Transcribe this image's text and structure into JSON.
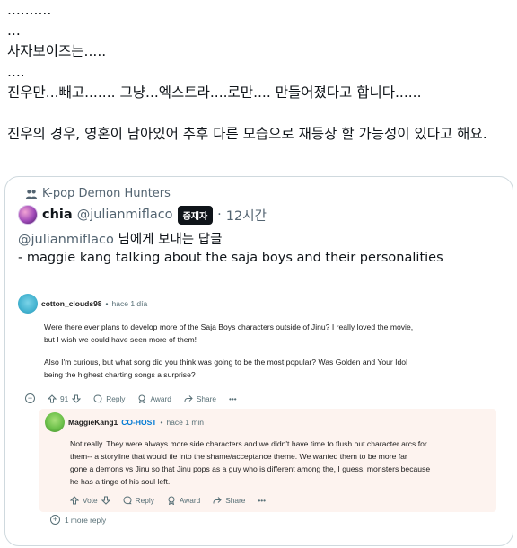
{
  "post": {
    "lines": [
      "..........",
      "...",
      "사자보이즈는.....",
      "....",
      "진우만...빼고....... 그냥...엑스트라....로만.... 만들어졌다고 합니다......",
      "",
      "진우의 경우, 영혼이 남아있어 추후 다른 모습으로 재등장 할 가능성이 있다고 해요."
    ]
  },
  "quote": {
    "community": "K-pop Demon Hunters",
    "author_name": "chia",
    "author_handle": "@julianmiflaco",
    "badge": "중재자",
    "separator": "·",
    "time": "12시간",
    "reply_to_mention": "@julianmiflaco",
    "reply_to_suffix": " 님에게 보내는 답글",
    "body": "- maggie kang talking about the saja boys and their personalities"
  },
  "reddit": {
    "comment1": {
      "user": "cotton_clouds98",
      "dot": "•",
      "time": "hace 1 día",
      "lines_p1": [
        "Were there ever plans to develop more of the Saja Boys characters outside of Jinu? I really loved the movie,",
        "but I wish we could have seen more of them!"
      ],
      "lines_p2": [
        "Also I'm curious, but what song did you think was going to be the most popular? Was Golden and Your Idol",
        "being the highest charting songs a surprise?"
      ],
      "collapse": "−",
      "votes": "91",
      "reply": "Reply",
      "award": "Award",
      "share": "Share",
      "more": "•••"
    },
    "comment2": {
      "user": "MaggieKang1",
      "role": "CO-HOST",
      "dot": "•",
      "time": "hace 1 min",
      "lines": [
        "Not really. They were always more side characters and we didn't have time to flush out character arcs for",
        "them-- a storyline that would tie into the shame/acceptance theme. We wanted them to be more far",
        "gone a demons vs Jinu so that Jinu pops as a guy who is different among the, I guess, monsters because",
        "he has a tinge of his soul left."
      ],
      "vote": "Vote",
      "reply": "Reply",
      "award": "Award",
      "share": "Share",
      "more": "•••"
    },
    "more_replies_icon": "+",
    "more_replies": "1 more reply"
  },
  "colors": {
    "text": "#0f1419",
    "muted": "#536471",
    "border": "#cfd9de",
    "badge_bg": "#0f1419",
    "cohost": "#0079d3",
    "nested_bg": "#fdf3ef"
  },
  "icons": [
    "community-icon",
    "upvote-icon",
    "downvote-icon",
    "comment-icon",
    "award-icon",
    "share-icon",
    "collapse-icon",
    "expand-icon"
  ]
}
